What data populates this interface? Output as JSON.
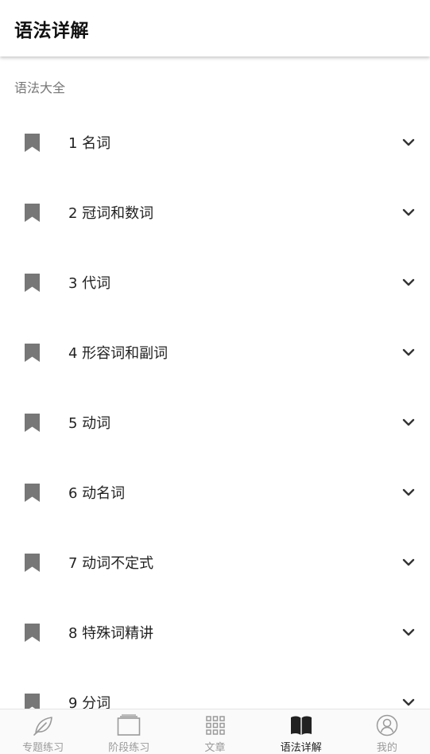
{
  "appbar": {
    "title": "语法详解"
  },
  "section": {
    "header": "语法大全"
  },
  "items": [
    {
      "label": "1 名词"
    },
    {
      "label": "2 冠词和数词"
    },
    {
      "label": "3 代词"
    },
    {
      "label": "4 形容词和副词"
    },
    {
      "label": "5 动词"
    },
    {
      "label": "6 动名词"
    },
    {
      "label": "7 动词不定式"
    },
    {
      "label": "8 特殊词精讲"
    },
    {
      "label": "9 分词"
    }
  ],
  "tabs": [
    {
      "label": "专题练习",
      "icon": "leaf-icon",
      "active": false
    },
    {
      "label": "阶段练习",
      "icon": "folder-icon",
      "active": false
    },
    {
      "label": "文章",
      "icon": "grid-icon",
      "active": false
    },
    {
      "label": "语法详解",
      "icon": "open-book-icon",
      "active": true
    },
    {
      "label": "我的",
      "icon": "user-icon",
      "active": false
    }
  ],
  "colors": {
    "icon_gray": "#777777",
    "tab_inactive": "#9a9a9a",
    "tab_active": "#222222"
  }
}
